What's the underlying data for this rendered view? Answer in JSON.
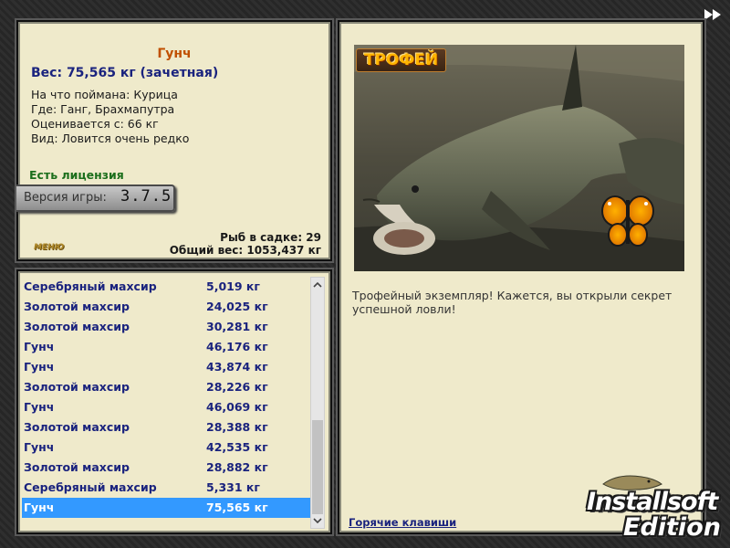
{
  "info": {
    "title": "Гунч",
    "weight": "Вес: 75,565 кг (зачетная)",
    "caught_on": "На что поймана: Курица",
    "where": "Где: Ганг, Брахмапутра",
    "value": "Оценивается с: 66 кг",
    "rarity": "Вид: Ловится очень редко",
    "license": "Есть лицензия",
    "version_label": "Версия игры:",
    "version_number": "3.7.5",
    "menu_logo": "МЕНЮ",
    "cage_count": "Рыб в садке: 29",
    "total_weight": "Общий вес: 1053,437 кг"
  },
  "catch_list": [
    {
      "name": "Серебряный махсир",
      "weight": "5,019 кг"
    },
    {
      "name": "Золотой махсир",
      "weight": "24,025 кг"
    },
    {
      "name": "Золотой махсир",
      "weight": "30,281 кг"
    },
    {
      "name": "Гунч",
      "weight": "46,176 кг"
    },
    {
      "name": "Гунч",
      "weight": "43,874 кг"
    },
    {
      "name": "Золотой махсир",
      "weight": "28,226 кг"
    },
    {
      "name": "Гунч",
      "weight": "46,069 кг"
    },
    {
      "name": "Золотой махсир",
      "weight": "28,388 кг"
    },
    {
      "name": "Гунч",
      "weight": "42,535 кг"
    },
    {
      "name": "Золотой махсир",
      "weight": "28,882 кг"
    },
    {
      "name": "Серебряный махсир",
      "weight": "5,331 кг"
    },
    {
      "name": "Гунч",
      "weight": "75,565 кг",
      "selected": true
    }
  ],
  "detail": {
    "badge": "ТРОФЕЙ",
    "text": "Трофейный экземпляр! Кажется, вы открыли секрет успешной ловли!",
    "hotkeys": "Горячие клавиши"
  },
  "brand": {
    "line1": "Installsoft",
    "line2": "Edition"
  },
  "icons": {
    "scroll_up": "chevron-up-icon",
    "scroll_down": "chevron-down-icon",
    "forward": "fast-forward-icon"
  },
  "colors": {
    "panel_bg": "#efeacb",
    "title": "#c05000",
    "list_text": "#1a237e",
    "selected_row": "#3399ff",
    "license": "#1b6e1b"
  },
  "scroll_position": 0.82
}
